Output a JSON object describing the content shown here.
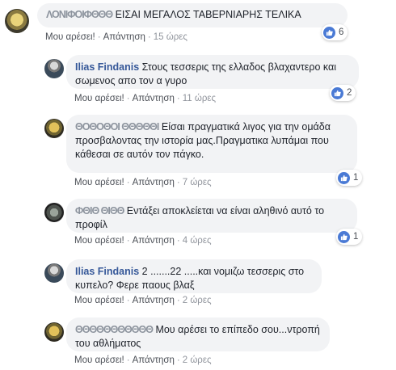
{
  "comments": [
    {
      "author": "",
      "author_obscured": "ΛΟΝΙΦΟΙΦΘΘΘ",
      "text": "ΕΙΣΑΙ ΜΕΓΑΛΟΣ ΤΑΒΕΡΝΙΑΡΗΣ ΤΕΛΙΚΑ",
      "like_label": "Μου αρέσει!",
      "reply_label": "Απάντηση",
      "time": "15 ώρες",
      "reactions": "6"
    },
    {
      "author": "Ilias Findanis",
      "text": "Στους τεσσερις της ελλαδος βλαχαντερο και σωμενος απο τον α γυρο",
      "like_label": "Μου αρέσει!",
      "reply_label": "Απάντηση",
      "time": "11 ώρες",
      "reactions": "2"
    },
    {
      "author": "",
      "author_obscured": "ΘΟΘΟΘΟΙ ΘΘΘΘΘΙ",
      "text": "Είσαι πραγματικά λιγος για την ομάδα προσβαλοντας την ιστορία μας.Πραγματικα λυπάμαι που κάθεσαι σε αυτόν τον πάγκο.",
      "like_label": "Μου αρέσει!",
      "reply_label": "Απάντηση",
      "time": "7 ώρες",
      "reactions": "1"
    },
    {
      "author": "",
      "author_obscured": "ΦΘΙΘ ΘΙΘΘ",
      "text": "Εντάξει αποκλείεται να είναι αληθινό αυτό το προφίλ",
      "like_label": "Μου αρέσει!",
      "reply_label": "Απάντηση",
      "time": "4 ώρες",
      "reactions": "1"
    },
    {
      "author": "Ilias Findanis",
      "text": "2 .......22 .....και νομιζω τεσσερις στο κυπελο? Φερε παους βλαξ",
      "like_label": "Μου αρέσει!",
      "reply_label": "Απάντηση",
      "time": "2 ώρες"
    },
    {
      "author": "",
      "author_obscured": "ΘΘΘΘΘΘΘΘΘΘΘ",
      "text": "Μου αρέσει το επίπεδο σου...ντροπή του αθλήματος",
      "like_label": "Μου αρέσει!",
      "reply_label": "Απάντηση",
      "time": "2 ώρες"
    }
  ],
  "colors": {
    "bubble": "#f2f3f5",
    "author_link": "#365899",
    "like_badge": "#4a7ad5"
  },
  "icons": [
    "avatar",
    "like-thumb-icon"
  ]
}
